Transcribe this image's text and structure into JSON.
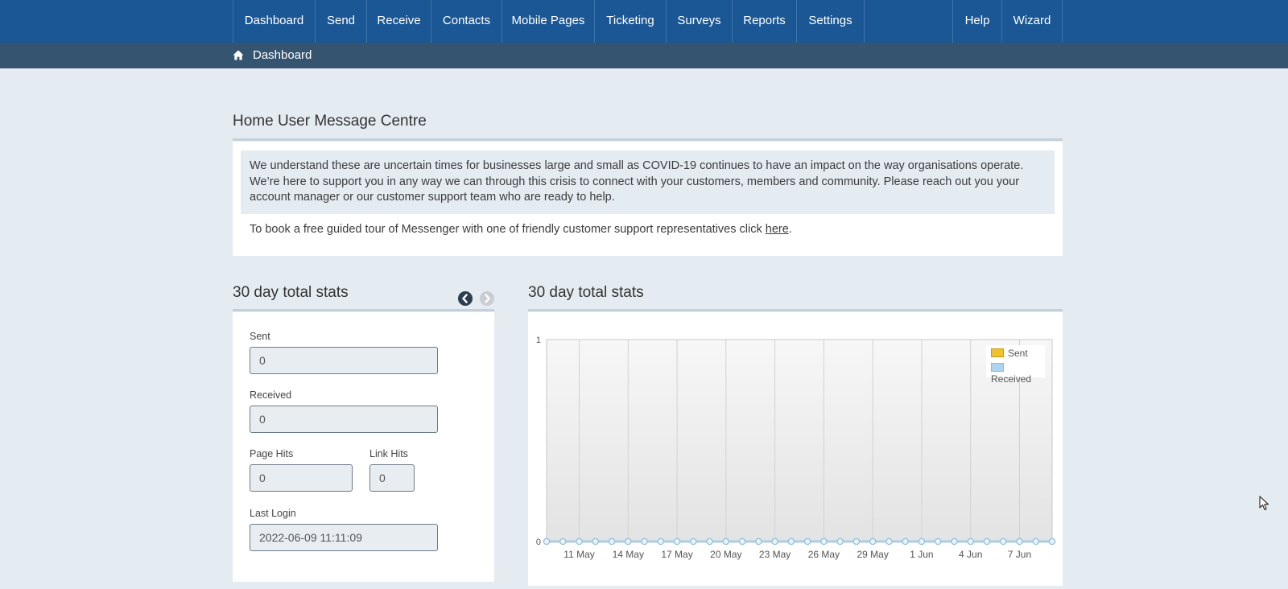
{
  "nav": {
    "items": [
      {
        "label": "Dashboard",
        "name": "nav-dashboard"
      },
      {
        "label": "Send",
        "name": "nav-send"
      },
      {
        "label": "Receive",
        "name": "nav-receive"
      },
      {
        "label": "Contacts",
        "name": "nav-contacts"
      },
      {
        "label": "Mobile Pages",
        "name": "nav-mobile-pages"
      },
      {
        "label": "Ticketing",
        "name": "nav-ticketing"
      },
      {
        "label": "Surveys",
        "name": "nav-surveys"
      },
      {
        "label": "Reports",
        "name": "nav-reports"
      },
      {
        "label": "Settings",
        "name": "nav-settings"
      }
    ],
    "right_items": [
      {
        "label": "Help",
        "name": "nav-help"
      },
      {
        "label": "Wizard",
        "name": "nav-wizard"
      }
    ],
    "bg_color": "#1a5794"
  },
  "breadcrumb": {
    "icon": "home-icon",
    "label": "Dashboard"
  },
  "message_centre": {
    "title": "Home User Message Centre",
    "notice": "We understand these are uncertain times for businesses large and small as COVID-19 continues to have an impact on the way organisations operate. We’re here to support you in any way we can through this crisis to connect with your customers, members and community. Please reach out you your account manager or our customer support team who are ready to help.",
    "tour_text": "To book a free guided tour of Messenger with one of friendly customer support representatives click ",
    "tour_link": "here",
    "tour_suffix": "."
  },
  "stats": {
    "title": "30 day total stats",
    "prev_icon": "chevron-left-circle-icon",
    "next_icon": "chevron-right-circle-icon",
    "sent_label": "Sent",
    "sent_value": "0",
    "received_label": "Received",
    "received_value": "0",
    "page_hits_label": "Page Hits",
    "page_hits_value": "0",
    "link_hits_label": "Link Hits",
    "link_hits_value": "0",
    "last_login_label": "Last Login",
    "last_login_value": "2022-06-09 11:11:09"
  },
  "chart": {
    "title": "30 day total stats"
  },
  "chart_data": {
    "type": "area",
    "x_ticks": [
      "11 May",
      "14 May",
      "17 May",
      "20 May",
      "23 May",
      "26 May",
      "29 May",
      "1 Jun",
      "4 Jun",
      "7 Jun"
    ],
    "point_count": 32,
    "ylim": [
      0,
      1
    ],
    "y_ticks": [
      "0",
      "1"
    ],
    "series": [
      {
        "name": "Sent",
        "color": "#f2c12e",
        "values": [
          0,
          0,
          0,
          0,
          0,
          0,
          0,
          0,
          0,
          0,
          0,
          0,
          0,
          0,
          0,
          0,
          0,
          0,
          0,
          0,
          0,
          0,
          0,
          0,
          0,
          0,
          0,
          0,
          0,
          0,
          0,
          0
        ]
      },
      {
        "name": "Received",
        "color": "#aed3ee",
        "values": [
          0,
          0,
          0,
          0,
          0,
          0,
          0,
          0,
          0,
          0,
          0,
          0,
          0,
          0,
          0,
          0,
          0,
          0,
          0,
          0,
          0,
          0,
          0,
          0,
          0,
          0,
          0,
          0,
          0,
          0,
          0,
          0
        ]
      }
    ],
    "grid": true,
    "legend_position": "top-right"
  }
}
